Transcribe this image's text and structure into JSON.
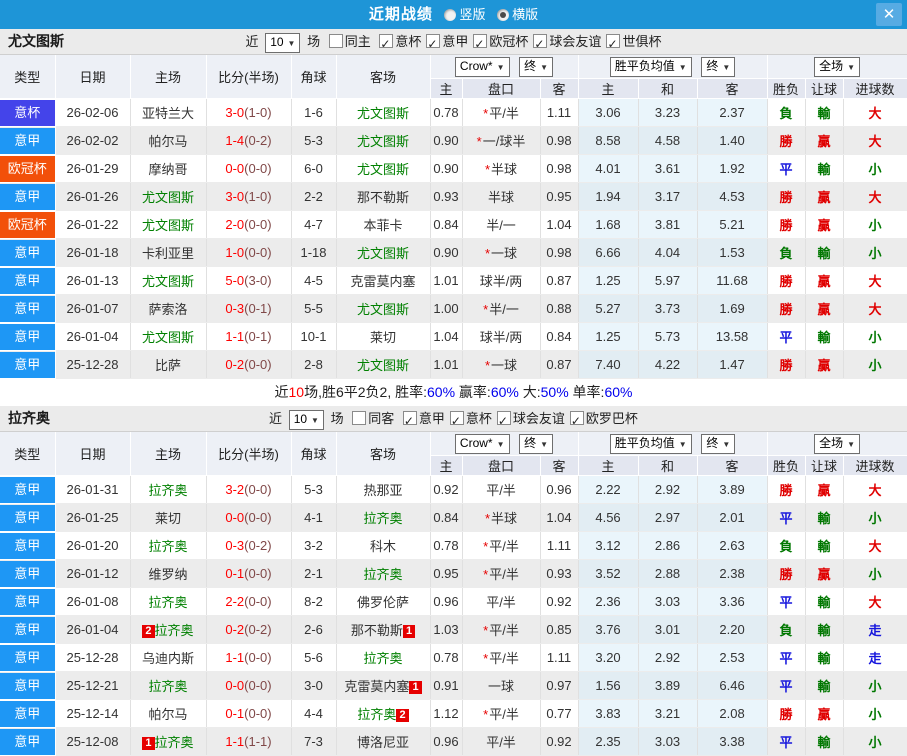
{
  "titlebar": {
    "title": "近期战绩",
    "vertical_label": "竖版",
    "horizontal_label": "横版",
    "close_label": "✕"
  },
  "table_head": {
    "type": "类型",
    "date": "日期",
    "home": "主场",
    "score": "比分(半场)",
    "corner": "角球",
    "away": "客场",
    "h": "主",
    "handicap": "盘口",
    "a": "客",
    "avg_h": "主",
    "avg_d": "和",
    "avg_a": "客",
    "result": "胜负",
    "let_ball": "让球",
    "goals": "进球数",
    "dd_book": "Crow*",
    "dd_final": "终",
    "dd_avg": "胜平负均值",
    "dd_final2": "终",
    "dd_scope": "全场"
  },
  "colors": {
    "titlebar_blue": "#1e95d7",
    "team_green": "#008000",
    "score_red": "#ff0000",
    "win_red": "#e00000",
    "draw_blue": "#1515dd",
    "lose_green": "#007700",
    "percent_blue": "#0000ee",
    "league_badges": {
      "意甲": "#1e97f5",
      "意杯": "#4444ea",
      "欧冠杯": "#f2500a"
    }
  },
  "sections": [
    {
      "team": "尤文图斯",
      "filter": {
        "near": "近",
        "count": "10",
        "games": "场",
        "same": "同主",
        "same_checked": false,
        "leagues": [
          "意杯",
          "意甲",
          "欧冠杯",
          "球会友谊",
          "世俱杯"
        ]
      },
      "rows": [
        {
          "lg": "意杯",
          "date": "26-02-06",
          "h": "亚特兰大",
          "hg": false,
          "sc": "3-0",
          "hf": "(1-0)",
          "cr": "1-6",
          "a": "尤文图斯",
          "ag": true,
          "o1": "0.78",
          "st": true,
          "hc": "平/半",
          "o2": "1.11",
          "m1": "3.06",
          "m2": "3.23",
          "m3": "2.37",
          "r1": "負",
          "r2": "輸",
          "r3": "大"
        },
        {
          "lg": "意甲",
          "date": "26-02-02",
          "h": "帕尔马",
          "hg": false,
          "sc": "1-4",
          "hf": "(0-2)",
          "cr": "5-3",
          "a": "尤文图斯",
          "ag": true,
          "o1": "0.90",
          "st": true,
          "hc": "一/球半",
          "o2": "0.98",
          "m1": "8.58",
          "m2": "4.58",
          "m3": "1.40",
          "r1": "勝",
          "r2": "贏",
          "r3": "大"
        },
        {
          "lg": "欧冠杯",
          "date": "26-01-29",
          "h": "摩纳哥",
          "hg": false,
          "sc": "0-0",
          "hf": "(0-0)",
          "cr": "6-0",
          "a": "尤文图斯",
          "ag": true,
          "o1": "0.90",
          "st": true,
          "hc": "半球",
          "o2": "0.98",
          "m1": "4.01",
          "m2": "3.61",
          "m3": "1.92",
          "r1": "平",
          "r2": "輸",
          "r3": "小"
        },
        {
          "lg": "意甲",
          "date": "26-01-26",
          "h": "尤文图斯",
          "hg": true,
          "sc": "3-0",
          "hf": "(1-0)",
          "cr": "2-2",
          "a": "那不勒斯",
          "ag": false,
          "o1": "0.93",
          "st": false,
          "hc": "半球",
          "o2": "0.95",
          "m1": "1.94",
          "m2": "3.17",
          "m3": "4.53",
          "r1": "勝",
          "r2": "贏",
          "r3": "大"
        },
        {
          "lg": "欧冠杯",
          "date": "26-01-22",
          "h": "尤文图斯",
          "hg": true,
          "sc": "2-0",
          "hf": "(0-0)",
          "cr": "4-7",
          "a": "本菲卡",
          "ag": false,
          "o1": "0.84",
          "st": false,
          "hc": "半/一",
          "o2": "1.04",
          "m1": "1.68",
          "m2": "3.81",
          "m3": "5.21",
          "r1": "勝",
          "r2": "贏",
          "r3": "小"
        },
        {
          "lg": "意甲",
          "date": "26-01-18",
          "h": "卡利亚里",
          "hg": false,
          "sc": "1-0",
          "hf": "(0-0)",
          "cr": "1-18",
          "a": "尤文图斯",
          "ag": true,
          "o1": "0.90",
          "st": true,
          "hc": "一球",
          "o2": "0.98",
          "m1": "6.66",
          "m2": "4.04",
          "m3": "1.53",
          "r1": "負",
          "r2": "輸",
          "r3": "小"
        },
        {
          "lg": "意甲",
          "date": "26-01-13",
          "h": "尤文图斯",
          "hg": true,
          "sc": "5-0",
          "hf": "(3-0)",
          "cr": "4-5",
          "a": "克雷莫内塞",
          "ag": false,
          "o1": "1.01",
          "st": false,
          "hc": "球半/两",
          "o2": "0.87",
          "m1": "1.25",
          "m2": "5.97",
          "m3": "11.68",
          "r1": "勝",
          "r2": "贏",
          "r3": "大"
        },
        {
          "lg": "意甲",
          "date": "26-01-07",
          "h": "萨索洛",
          "hg": false,
          "sc": "0-3",
          "hf": "(0-1)",
          "cr": "5-5",
          "a": "尤文图斯",
          "ag": true,
          "o1": "1.00",
          "st": true,
          "hc": "半/一",
          "o2": "0.88",
          "m1": "5.27",
          "m2": "3.73",
          "m3": "1.69",
          "r1": "勝",
          "r2": "贏",
          "r3": "大"
        },
        {
          "lg": "意甲",
          "date": "26-01-04",
          "h": "尤文图斯",
          "hg": true,
          "sc": "1-1",
          "hf": "(0-1)",
          "cr": "10-1",
          "a": "莱切",
          "ag": false,
          "o1": "1.04",
          "st": false,
          "hc": "球半/两",
          "o2": "0.84",
          "m1": "1.25",
          "m2": "5.73",
          "m3": "13.58",
          "r1": "平",
          "r2": "輸",
          "r3": "小"
        },
        {
          "lg": "意甲",
          "date": "25-12-28",
          "h": "比萨",
          "hg": false,
          "sc": "0-2",
          "hf": "(0-0)",
          "cr": "2-8",
          "a": "尤文图斯",
          "ag": true,
          "o1": "1.01",
          "st": true,
          "hc": "一球",
          "o2": "0.87",
          "m1": "7.40",
          "m2": "4.22",
          "m3": "1.47",
          "r1": "勝",
          "r2": "贏",
          "r3": "小"
        }
      ],
      "summary": [
        {
          "t": "近",
          "c": "k"
        },
        {
          "t": "10",
          "c": "r"
        },
        {
          "t": "场,胜6平2负2, 胜率:",
          "c": "k"
        },
        {
          "t": "60%",
          "c": "b"
        },
        {
          "t": " 赢率:",
          "c": "k"
        },
        {
          "t": "60%",
          "c": "b"
        },
        {
          "t": " 大:",
          "c": "k"
        },
        {
          "t": "50%",
          "c": "b"
        },
        {
          "t": " 单率:",
          "c": "k"
        },
        {
          "t": "60%",
          "c": "b"
        }
      ]
    },
    {
      "team": "拉齐奥",
      "filter": {
        "near": "近",
        "count": "10",
        "games": "场",
        "same": "同客",
        "same_checked": false,
        "leagues": [
          "意甲",
          "意杯",
          "球会友谊",
          "欧罗巴杯"
        ]
      },
      "rows": [
        {
          "lg": "意甲",
          "date": "26-01-31",
          "h": "拉齐奥",
          "hg": true,
          "sc": "3-2",
          "hf": "(0-0)",
          "cr": "5-3",
          "a": "热那亚",
          "ag": false,
          "o1": "0.92",
          "st": false,
          "hc": "平/半",
          "o2": "0.96",
          "m1": "2.22",
          "m2": "2.92",
          "m3": "3.89",
          "r1": "勝",
          "r2": "贏",
          "r3": "大"
        },
        {
          "lg": "意甲",
          "date": "26-01-25",
          "h": "莱切",
          "hg": false,
          "sc": "0-0",
          "hf": "(0-0)",
          "cr": "4-1",
          "a": "拉齐奥",
          "ag": true,
          "o1": "0.84",
          "st": true,
          "hc": "半球",
          "o2": "1.04",
          "m1": "4.56",
          "m2": "2.97",
          "m3": "2.01",
          "r1": "平",
          "r2": "輸",
          "r3": "小"
        },
        {
          "lg": "意甲",
          "date": "26-01-20",
          "h": "拉齐奥",
          "hg": true,
          "sc": "0-3",
          "hf": "(0-2)",
          "cr": "3-2",
          "a": "科木",
          "ag": false,
          "o1": "0.78",
          "st": true,
          "hc": "平/半",
          "o2": "1.11",
          "m1": "3.12",
          "m2": "2.86",
          "m3": "2.63",
          "r1": "負",
          "r2": "輸",
          "r3": "大"
        },
        {
          "lg": "意甲",
          "date": "26-01-12",
          "h": "维罗纳",
          "hg": false,
          "sc": "0-1",
          "hf": "(0-0)",
          "cr": "2-1",
          "a": "拉齐奥",
          "ag": true,
          "o1": "0.95",
          "st": true,
          "hc": "平/半",
          "o2": "0.93",
          "m1": "3.52",
          "m2": "2.88",
          "m3": "2.38",
          "r1": "勝",
          "r2": "贏",
          "r3": "小"
        },
        {
          "lg": "意甲",
          "date": "26-01-08",
          "h": "拉齐奥",
          "hg": true,
          "sc": "2-2",
          "hf": "(0-0)",
          "cr": "8-2",
          "a": "佛罗伦萨",
          "ag": false,
          "o1": "0.96",
          "st": false,
          "hc": "平/半",
          "o2": "0.92",
          "m1": "2.36",
          "m2": "3.03",
          "m3": "3.36",
          "r1": "平",
          "r2": "輸",
          "r3": "大"
        },
        {
          "lg": "意甲",
          "date": "26-01-04",
          "h": "拉齐奥",
          "hg": true,
          "hcb": "2",
          "sc": "0-2",
          "hf": "(0-2)",
          "cr": "2-6",
          "a": "那不勒斯",
          "ag": false,
          "aca": "1",
          "o1": "1.03",
          "st": true,
          "hc": "平/半",
          "o2": "0.85",
          "m1": "3.76",
          "m2": "3.01",
          "m3": "2.20",
          "r1": "負",
          "r2": "輸",
          "r3": "走"
        },
        {
          "lg": "意甲",
          "date": "25-12-28",
          "h": "乌迪内斯",
          "hg": false,
          "sc": "1-1",
          "hf": "(0-0)",
          "cr": "5-6",
          "a": "拉齐奥",
          "ag": true,
          "o1": "0.78",
          "st": true,
          "hc": "平/半",
          "o2": "1.11",
          "m1": "3.20",
          "m2": "2.92",
          "m3": "2.53",
          "r1": "平",
          "r2": "輸",
          "r3": "走"
        },
        {
          "lg": "意甲",
          "date": "25-12-21",
          "h": "拉齐奥",
          "hg": true,
          "sc": "0-0",
          "hf": "(0-0)",
          "cr": "3-0",
          "a": "克雷莫内塞",
          "ag": false,
          "aca": "1",
          "o1": "0.91",
          "st": false,
          "hc": "一球",
          "o2": "0.97",
          "m1": "1.56",
          "m2": "3.89",
          "m3": "6.46",
          "r1": "平",
          "r2": "輸",
          "r3": "小"
        },
        {
          "lg": "意甲",
          "date": "25-12-14",
          "h": "帕尔马",
          "hg": false,
          "sc": "0-1",
          "hf": "(0-0)",
          "cr": "4-4",
          "a": "拉齐奥",
          "ag": true,
          "aca": "2",
          "o1": "1.12",
          "st": true,
          "hc": "平/半",
          "o2": "0.77",
          "m1": "3.83",
          "m2": "3.21",
          "m3": "2.08",
          "r1": "勝",
          "r2": "贏",
          "r3": "小"
        },
        {
          "lg": "意甲",
          "date": "25-12-08",
          "h": "拉齐奥",
          "hg": true,
          "hcb": "1",
          "sc": "1-1",
          "hf": "(1-1)",
          "cr": "7-3",
          "a": "博洛尼亚",
          "ag": false,
          "o1": "0.96",
          "st": false,
          "hc": "平/半",
          "o2": "0.92",
          "m1": "2.35",
          "m2": "3.03",
          "m3": "3.38",
          "r1": "平",
          "r2": "輸",
          "r3": "小"
        }
      ]
    }
  ]
}
